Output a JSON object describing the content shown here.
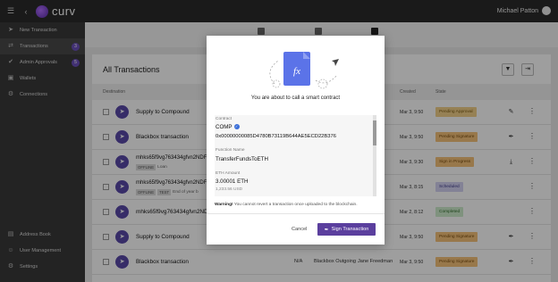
{
  "app": {
    "brand": "curv",
    "user_name": "Michael Patton"
  },
  "sidebar": {
    "items": [
      {
        "label": "New Transaction",
        "icon": "send-icon"
      },
      {
        "label": "Transactions",
        "icon": "swap-icon",
        "badge": "3",
        "active": true
      },
      {
        "label": "Admin Approvals",
        "icon": "approval-icon",
        "badge": "5"
      },
      {
        "label": "Wallets",
        "icon": "wallet-icon"
      },
      {
        "label": "Connections",
        "icon": "connections-icon"
      }
    ],
    "bottom_items": [
      {
        "label": "Address Book",
        "icon": "address-book-icon"
      },
      {
        "label": "User Management",
        "icon": "users-icon"
      },
      {
        "label": "Settings",
        "icon": "gear-icon"
      }
    ]
  },
  "table": {
    "title": "All Transactions",
    "headers": {
      "destination": "Destination",
      "created": "Created",
      "state": "State"
    },
    "rows": [
      {
        "title": "Supply to Compound",
        "date": "Mar 3, 9:50",
        "status": "Pending Approval",
        "status_bg": "#f3d08a",
        "status_fg": "#7a5a12",
        "action_icon": "approve-icon"
      },
      {
        "title": "Blackbox transaction",
        "date": "Mar 3, 9:50",
        "status": "Pending Signature",
        "status_bg": "#f5c27a",
        "status_fg": "#7a4d0e",
        "action_icon": "pen-icon"
      },
      {
        "title": "mhks65f9vg763434gfvn2NDF",
        "tags": [
          "OFFLINE"
        ],
        "note": "Loan",
        "date": "Mar 3, 9:30",
        "status": "Sign in Progress",
        "status_bg": "#f5c27a",
        "status_fg": "#7a4d0e",
        "action_icon": "download-icon"
      },
      {
        "title": "mhks65f9vg763434gfvn2NDF",
        "tags": [
          "OFFLINE",
          "TEST"
        ],
        "note": "End of year b",
        "date": "Mar 3, 8:15",
        "status": "Scheduled",
        "status_bg": "#d4d2f3",
        "status_fg": "#3d3a8a",
        "action_icon": ""
      },
      {
        "title": "mhks65f9vg763434gfvn2NDF",
        "date": "Mar 2, 8:12",
        "status": "Completed",
        "status_bg": "#cdeccb",
        "status_fg": "#2f6b2c",
        "action_icon": ""
      },
      {
        "title": "Supply to Compound",
        "date": "Mar 3, 9:50",
        "status": "Pending Signature",
        "status_bg": "#f5c27a",
        "status_fg": "#7a4d0e",
        "action_icon": "pen-icon"
      },
      {
        "title": "Blackbox transaction",
        "amount": "N/A",
        "type": "Blackbox Outgoing",
        "initiator": "Jane Freedman",
        "date": "Mar 3, 9:50",
        "status": "Pending Signature",
        "status_bg": "#f5c27a",
        "status_fg": "#7a4d0e",
        "action_icon": "pen-icon"
      }
    ]
  },
  "modal": {
    "heading": "You are about to call a smart contract",
    "contract_label": "Contract",
    "contract_name": "COMP",
    "contract_address": "0x00000000085D4780B73119B644AE5ECD22B376",
    "function_label": "Function Name",
    "function_name": "TransferFundsToETH",
    "amount_label": "ETH Amount",
    "amount_value": "3.00001 ETH",
    "amount_usd": "1,233.56 USD",
    "warning_bold": "Warning!",
    "warning_text": "You cannot revert a transaction once uploaded to the blockchain.",
    "cancel_label": "Cancel",
    "sign_label": "Sign Transaction"
  },
  "colors": {
    "accent": "#5b3f9e",
    "topbar": "#2b2b2b",
    "sidebar": "#393939"
  }
}
